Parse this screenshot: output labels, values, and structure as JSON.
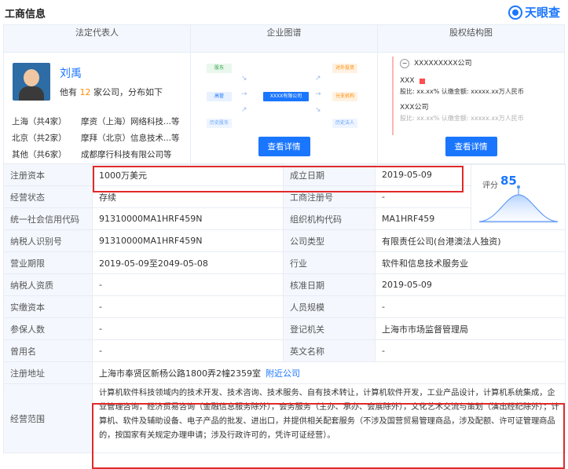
{
  "header": {
    "title": "工商信息",
    "brand": "天眼查"
  },
  "top": {
    "col_titles": [
      "法定代表人",
      "企业图谱",
      "股权结构图"
    ],
    "person": {
      "name": "刘禹",
      "desc_prefix": "他有",
      "count": "12",
      "desc_suffix": "家公司，分布如下"
    },
    "relations": [
      {
        "region": "上海（共4家）",
        "companies": "摩资（上海）网络科技...等"
      },
      {
        "region": "北京（共2家）",
        "companies": "摩拜（北京）信息技术...等"
      },
      {
        "region": "其他（共6家）",
        "companies": "成都摩行科技有限公司等"
      }
    ],
    "graph": {
      "n1": "股东",
      "n2": "高管",
      "n3": "历史股东",
      "center": "XXXX有限公司",
      "r1": "对外投资",
      "r2": "分支机构",
      "r3": "历史法人"
    },
    "equity": {
      "company": "XXXXXXXXX公司",
      "share1_name": "XXX",
      "share1_detail": "股比: xx.xx% 认缴金额: xxxxx.xx万人民币",
      "share2_name": "XXX公司",
      "share2_detail": "股比: xx.xx% 认缴金额: xxxxx.xx万人民币"
    },
    "detail_button": "查看详情"
  },
  "score": {
    "label": "评分",
    "value": "85"
  },
  "rows": [
    {
      "l1": "注册资本",
      "v1": "1000万美元",
      "l2": "成立日期",
      "v2": "2019-05-09"
    },
    {
      "l1": "经营状态",
      "v1": "存续",
      "l2": "工商注册号",
      "v2": "-"
    },
    {
      "l1": "统一社会信用代码",
      "v1": "91310000MA1HRF459N",
      "l2": "组织机构代码",
      "v2": "MA1HRF459"
    },
    {
      "l1": "纳税人识别号",
      "v1": "91310000MA1HRF459N",
      "l2": "公司类型",
      "v2": "有限责任公司(台港澳法人独资)"
    },
    {
      "l1": "营业期限",
      "v1": "2019-05-09至2049-05-08",
      "l2": "行业",
      "v2": "软件和信息技术服务业"
    },
    {
      "l1": "纳税人资质",
      "v1": "-",
      "l2": "核准日期",
      "v2": "2019-05-09"
    },
    {
      "l1": "实缴资本",
      "v1": "-",
      "l2": "人员规模",
      "v2": "-"
    },
    {
      "l1": "参保人数",
      "v1": "-",
      "l2": "登记机关",
      "v2": "上海市市场监督管理局"
    },
    {
      "l1": "曾用名",
      "v1": "-",
      "l2": "英文名称",
      "v2": "-"
    }
  ],
  "address": {
    "label": "注册地址",
    "value": "上海市奉贤区新杨公路1800弄2幢2359室",
    "link": "附近公司"
  },
  "scope": {
    "label": "经营范围",
    "value": "计算机软件科技领域内的技术开发、技术咨询、技术服务、自有技术转让，计算机软件开发，工业产品设计，计算机系统集成，企业管理咨询，经济贸易咨询（金融信息服务除外），会务服务（主办、承办、会展除外），文化艺术交流与策划（演出经纪除外）；计算机、软件及辅助设备、电子产品的批发、进出口，并提供相关配套服务（不涉及国营贸易管理商品，涉及配额、许可证管理商品的，按国家有关规定办理申请；涉及行政许可的，凭许可证经营）。"
  }
}
